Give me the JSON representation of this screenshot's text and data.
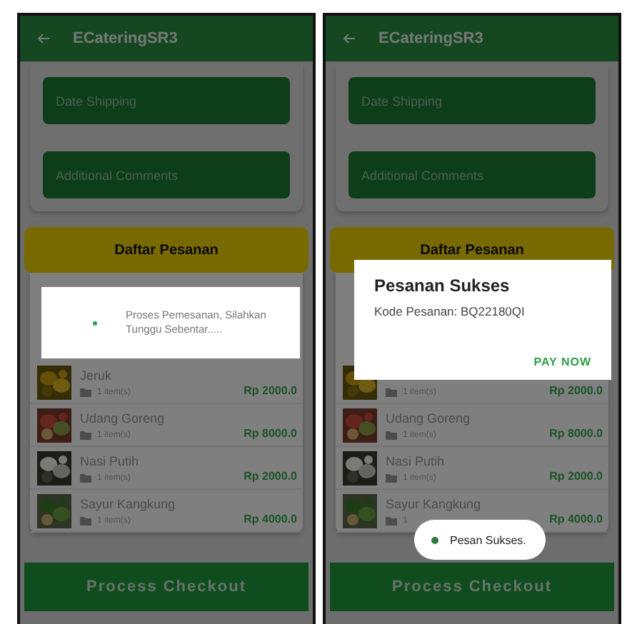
{
  "screens": [
    {
      "app_bar": {
        "title": "ECateringSR3"
      },
      "fields": [
        {
          "placeholder": "Date Shipping"
        },
        {
          "placeholder": "Additional Comments"
        }
      ],
      "section_title": "Daftar Pesanan",
      "items": [
        {
          "name": "Jeruk",
          "quantity": "1 item(s)",
          "price": "Rp 2000.0"
        },
        {
          "name": "Udang Goreng",
          "quantity": "1 item(s)",
          "price": "Rp 8000.0"
        },
        {
          "name": "Nasi Putih",
          "quantity": "1 item(s)",
          "price": "Rp 2000.0"
        },
        {
          "name": "Sayur Kangkung",
          "quantity": "1 item(s)",
          "price": "Rp 4000.0"
        }
      ],
      "checkout_button": "Process Checkout",
      "dialog": {
        "kind": "progress",
        "message": "Proses Pemesanan, Silahkan Tunggu Sebentar....."
      }
    },
    {
      "app_bar": {
        "title": "ECateringSR3"
      },
      "fields": [
        {
          "placeholder": "Date Shipping"
        },
        {
          "placeholder": "Additional Comments"
        }
      ],
      "section_title": "Daftar Pesanan",
      "items": [
        {
          "quantity": "1 item(s)",
          "price": "Rp 2000.0"
        },
        {
          "name": "Udang Goreng",
          "quantity": "1 item(s)",
          "price": "Rp 8000.0"
        },
        {
          "name": "Nasi Putih",
          "quantity": "1 item(s)",
          "price": "Rp 2000.0"
        },
        {
          "name": "Sayur Kangkung",
          "quantity": "1",
          "price": "Rp 4000.0"
        }
      ],
      "checkout_button": "Process Checkout",
      "dialog": {
        "kind": "alert",
        "title": "Pesanan Sukses",
        "message": "Kode Pesanan: BQ22180QI",
        "action": "PAY NOW"
      },
      "toast": "Pesan Sukses."
    }
  ]
}
